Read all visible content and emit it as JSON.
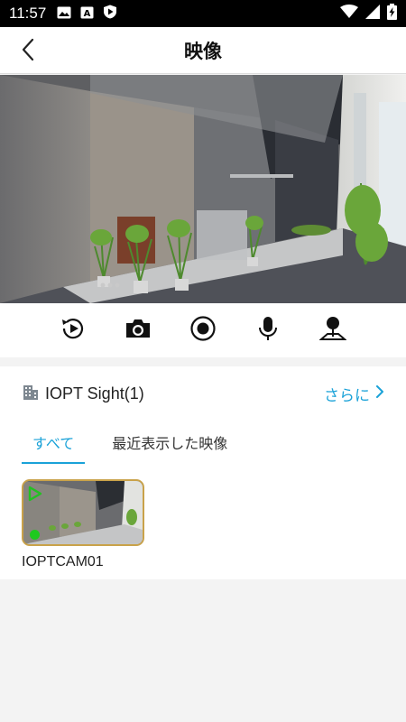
{
  "status_bar": {
    "time": "11:57",
    "left_icons": [
      "image-icon",
      "a-badge-icon",
      "shield-play-icon"
    ],
    "right_icons": [
      "wifi-icon",
      "signal-icon",
      "battery-charging-icon"
    ]
  },
  "header": {
    "title": "映像",
    "back_icon": "chevron-left-icon"
  },
  "video": {
    "page_indicator_count": 3
  },
  "controls": [
    {
      "name": "playback-button",
      "icon": "replay-play-icon"
    },
    {
      "name": "snapshot-button",
      "icon": "camera-icon"
    },
    {
      "name": "record-button",
      "icon": "record-icon"
    },
    {
      "name": "talk-button",
      "icon": "microphone-icon"
    },
    {
      "name": "ptz-button",
      "icon": "joystick-icon"
    }
  ],
  "site": {
    "name": "IOPT Sight(1)",
    "icon": "building-icon",
    "more_label": "さらに"
  },
  "tabs": [
    {
      "label": "すべて",
      "active": true
    },
    {
      "label": "最近表示した映像",
      "active": false
    }
  ],
  "cameras": [
    {
      "name": "IOPTCAM01",
      "online": true
    }
  ],
  "colors": {
    "accent": "#1aa2d8",
    "thumb_border": "#c9a24a",
    "online": "#1ec91e",
    "play_icon": "#22c222"
  }
}
